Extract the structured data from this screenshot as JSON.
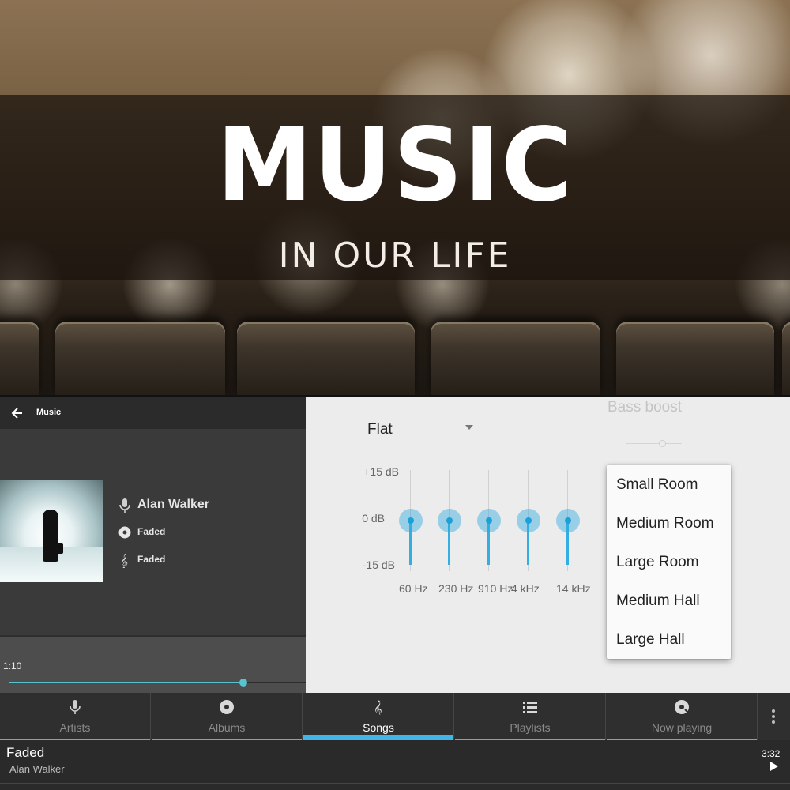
{
  "banner": {
    "title": "MUSIC",
    "subtitle": "IN OUR LIFE"
  },
  "player": {
    "toolbar_title": "Music",
    "artist": "Alan Walker",
    "album": "Faded",
    "song": "Faded",
    "elapsed": "1:10",
    "progress_fraction": 0.79,
    "icons": {
      "back": "arrow-left-icon",
      "artist": "microphone-icon",
      "album": "disc-icon",
      "song": "treble-clef-icon"
    }
  },
  "equalizer": {
    "preset": "Flat",
    "bass_boost_label": "Bass boost",
    "db_labels": {
      "top": "+15 dB",
      "mid": "0 dB",
      "bottom": "-15 dB"
    },
    "bands": [
      {
        "freq": "60 Hz",
        "gain_db": 0
      },
      {
        "freq": "230 Hz",
        "gain_db": 0
      },
      {
        "freq": "910 Hz",
        "gain_db": 0
      },
      {
        "freq": "4 kHz",
        "gain_db": 0
      },
      {
        "freq": "14 kHz",
        "gain_db": 0
      }
    ],
    "reverb_options": [
      "Small Room",
      "Medium Room",
      "Large Room",
      "Medium Hall",
      "Large Hall"
    ],
    "accent_color": "#32aee0"
  },
  "tabs": [
    {
      "label": "Artists",
      "icon": "microphone-icon",
      "active": false
    },
    {
      "label": "Albums",
      "icon": "disc-icon",
      "active": false
    },
    {
      "label": "Songs",
      "icon": "treble-clef-icon",
      "active": true
    },
    {
      "label": "Playlists",
      "icon": "list-icon",
      "active": false
    },
    {
      "label": "Now playing",
      "icon": "now-playing-icon",
      "active": false
    }
  ],
  "song_list": [
    {
      "title": "Faded",
      "artist": "Alan Walker",
      "duration": "3:32"
    }
  ]
}
